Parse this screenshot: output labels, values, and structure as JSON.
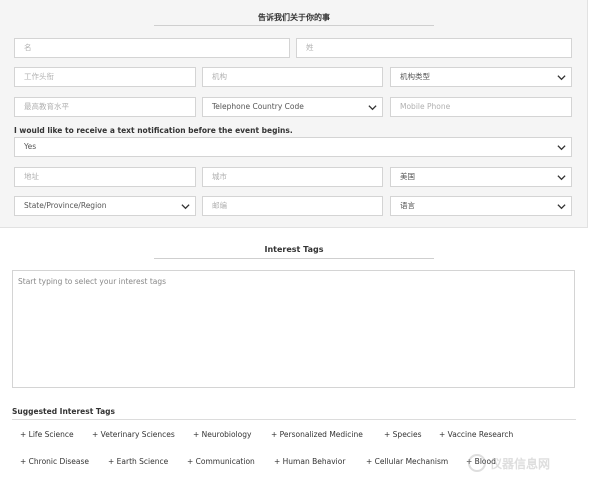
{
  "form": {
    "title": "告诉我们关于你的事",
    "first_name_placeholder": "名",
    "last_name_placeholder": "姓",
    "job_title_placeholder": "工作头衔",
    "institution_placeholder": "机构",
    "institution_type_label": "机构类型",
    "education_placeholder": "最高教育水平",
    "country_code_label": "Telephone Country Code",
    "mobile_placeholder": "Mobile Phone",
    "sms_question": "I would like to receive a text notification before the event begins.",
    "sms_value": "Yes",
    "address_placeholder": "地址",
    "city_placeholder": "城市",
    "country_label": "美国",
    "state_label": "State/Province/Region",
    "postal_placeholder": "邮编",
    "language_label": "语言"
  },
  "interest": {
    "title": "Interest Tags",
    "input_placeholder": "Start typing to select your interest tags",
    "suggested_title": "Suggested Interest Tags",
    "tags_row1": [
      "+ Life Science",
      "+ Veterinary Sciences",
      "+ Neurobiology",
      "+ Personalized Medicine",
      "+ Species",
      "+ Vaccine Research"
    ],
    "tags_row2": [
      "+ Chronic Disease",
      "+ Earth Science",
      "+ Communication",
      "+ Human Behavior",
      "+ Cellular Mechanism",
      "+ Blood"
    ]
  },
  "watermark": {
    "text": "仪器信息网"
  },
  "colors": {
    "panel_bg": "#f5f5f5",
    "border": "#d4d4d4",
    "text": "#333333"
  }
}
